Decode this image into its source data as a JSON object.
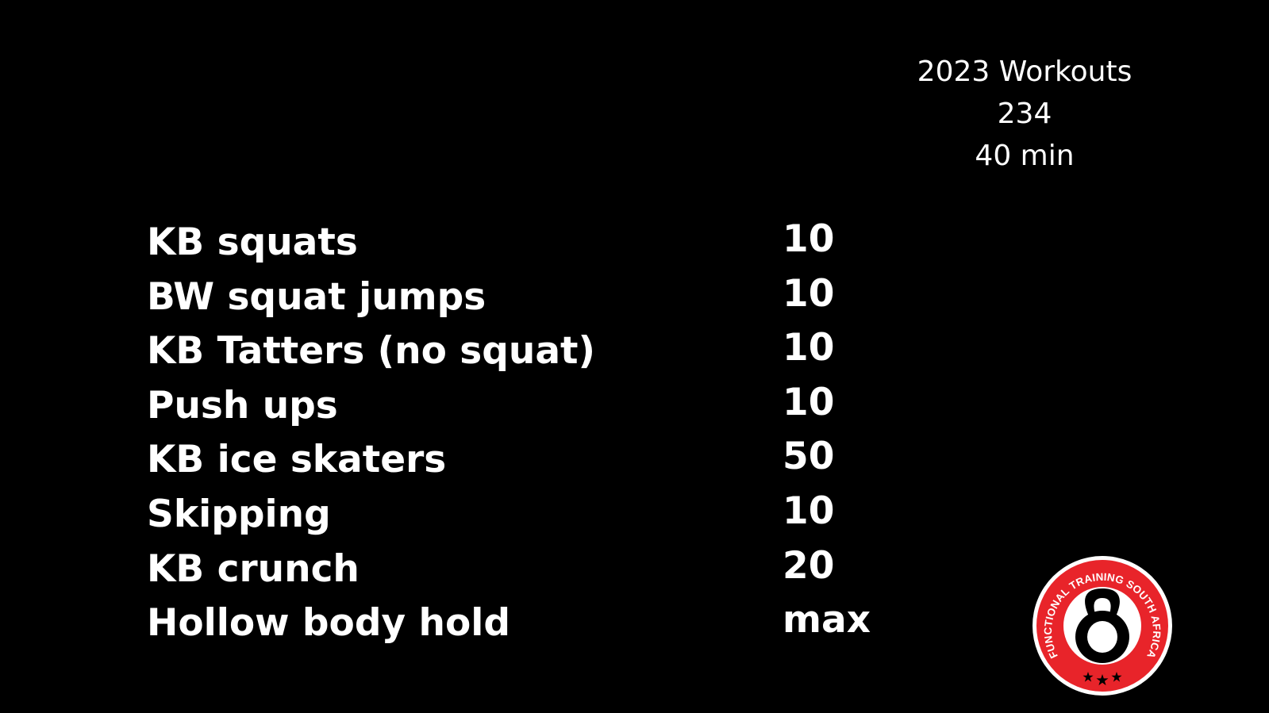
{
  "header": {
    "title": "2023 Workouts",
    "workout_number": "234",
    "duration": "40 min"
  },
  "workouts": [
    {
      "exercise": "KB squats",
      "reps": "10"
    },
    {
      "exercise": "BW squat jumps",
      "reps": "10"
    },
    {
      "exercise": "KB Tatters (no squat)",
      "reps": "10"
    },
    {
      "exercise": "Push ups",
      "reps": "10"
    },
    {
      "exercise": "KB ice skaters",
      "reps": "50"
    },
    {
      "exercise": "Skipping",
      "reps": "10"
    },
    {
      "exercise": "KB crunch",
      "reps": "20"
    },
    {
      "exercise": "Hollow body hold",
      "reps": "max"
    }
  ],
  "logo": {
    "text": "FUNCTIONAL TRAINING SOUTH AFRICA",
    "icon": "kettlebell-icon",
    "ring_color": "#e8242a",
    "inner_color": "#ffffff",
    "kettlebell_color": "#000000"
  },
  "colors": {
    "background": "#000000",
    "text": "#ffffff"
  }
}
